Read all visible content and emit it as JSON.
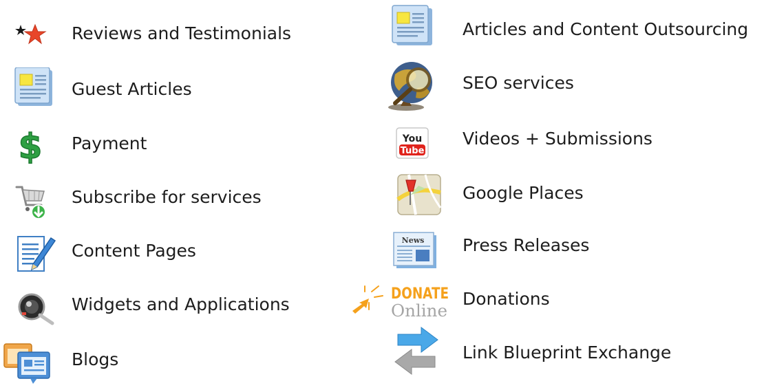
{
  "left_menu": {
    "items": [
      {
        "label": "Reviews and Testimonials",
        "icon": "star-rating-icon"
      },
      {
        "label": "Guest Articles",
        "icon": "article-icon"
      },
      {
        "label": "Payment",
        "icon": "dollar-sign-icon"
      },
      {
        "label": "Subscribe for services",
        "icon": "shopping-cart-icon"
      },
      {
        "label": "Content Pages",
        "icon": "edit-document-icon"
      },
      {
        "label": "Widgets and Applications",
        "icon": "magnifier-gadget-icon"
      },
      {
        "label": "Blogs",
        "icon": "blog-windows-icon"
      }
    ]
  },
  "right_menu": {
    "items": [
      {
        "label": "Articles and Content Outsourcing",
        "icon": "article-icon"
      },
      {
        "label": "SEO services",
        "icon": "globe-magnifier-icon"
      },
      {
        "label": "Videos + Submissions",
        "icon": "youtube-icon",
        "icon_text_top": "You",
        "icon_text_bottom": "Tube"
      },
      {
        "label": "Google Places",
        "icon": "map-pin-icon"
      },
      {
        "label": "Press Releases",
        "icon": "newspaper-icon",
        "icon_text": "News"
      },
      {
        "label": "Donations",
        "icon": "donate-online-icon",
        "icon_text_top": "DONATE",
        "icon_text_bottom": "Online"
      },
      {
        "label": "Link Blueprint Exchange",
        "icon": "exchange-arrows-icon"
      }
    ]
  },
  "colors": {
    "text": "#1d1d1d",
    "star": "#e8462a",
    "dollar": "#2ea043",
    "article_paper": "#bcd8f3",
    "article_highlight": "#f7e640",
    "youtube_red": "#e0231c",
    "donate_orange": "#f5a11c",
    "arrow_blue": "#4aa8e8",
    "arrow_gray": "#a9a9a9"
  }
}
